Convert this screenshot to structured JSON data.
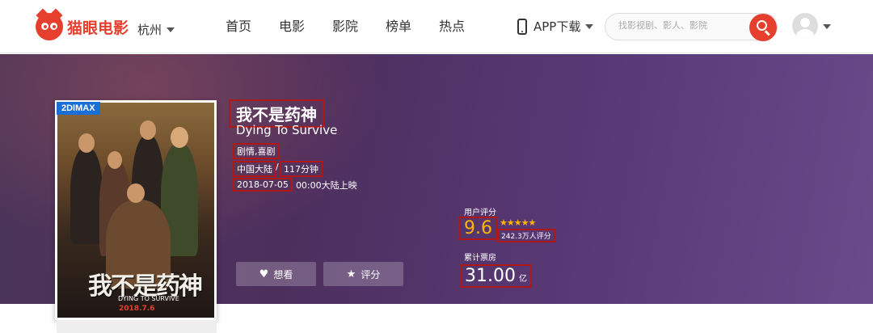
{
  "header": {
    "logo_text": "猫眼电影",
    "city": "杭州",
    "nav": [
      "首页",
      "电影",
      "影院",
      "榜单",
      "热点"
    ],
    "app_download": "APP下载",
    "search_placeholder": "找影视剧、影人、影院"
  },
  "movie": {
    "poster_tag": "2DIMAX",
    "poster_title_art": "我不是药神",
    "poster_subtitle_art": "DYING TO SURVIVE",
    "poster_date_art": "2018.7.6",
    "title_cn": "我不是药神",
    "title_en": "Dying To Survive",
    "genre": "剧情,喜剧",
    "origin": "中国大陆",
    "separator": "/",
    "duration": "117分钟",
    "release_date": "2018-07-05",
    "release_rest": "00:00大陆上映"
  },
  "actions": {
    "want": "想看",
    "rate": "评分"
  },
  "rating": {
    "label": "用户评分",
    "score": "9.6",
    "stars": "★★★★★",
    "votes": "242.3万人评分"
  },
  "box_office": {
    "label": "累计票房",
    "value": "31.00",
    "unit": "亿"
  },
  "colors": {
    "brand": "#e63f2e",
    "highlight_box": "#b01818",
    "score": "#ffb400",
    "tag": "#1a6fd6"
  }
}
